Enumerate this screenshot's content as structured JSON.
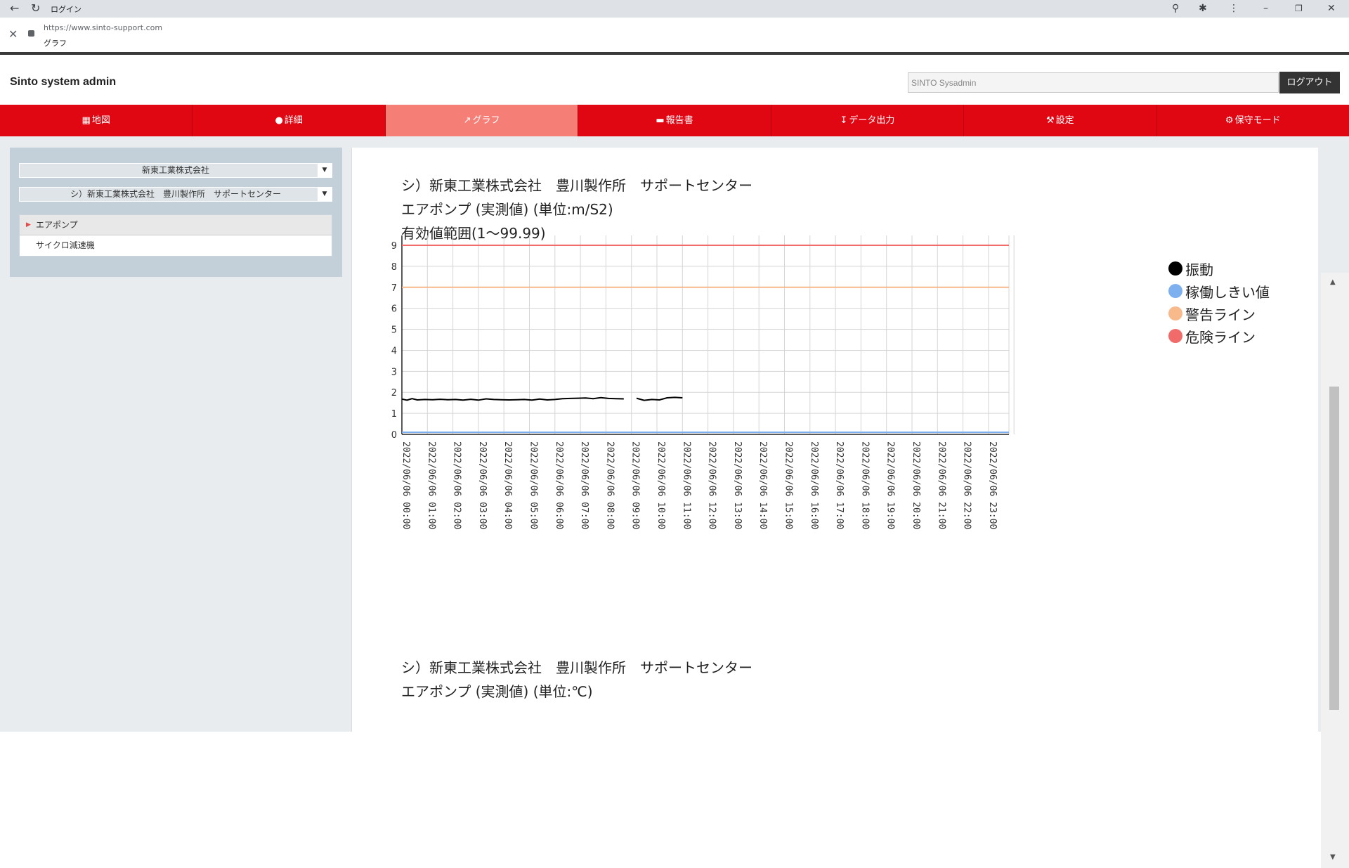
{
  "browser": {
    "tab_title": "ログイン",
    "url": "https://www.sinto-support.com",
    "page_label": "グラフ"
  },
  "header": {
    "app_title": "Sinto system admin",
    "user_value": "SINTO Sysadmin",
    "logout_label": "ログアウト"
  },
  "nav": [
    {
      "label": "地図",
      "icon": "map-icon"
    },
    {
      "label": "詳細",
      "icon": "map-marker-icon"
    },
    {
      "label": "グラフ",
      "icon": "line-chart-icon",
      "active": true
    },
    {
      "label": "報告書",
      "icon": "book-icon"
    },
    {
      "label": "データ出力",
      "icon": "download-icon"
    },
    {
      "label": "設定",
      "icon": "wrench-icon"
    },
    {
      "label": "保守モード",
      "icon": "gear-icon"
    }
  ],
  "sidebar": {
    "company_select": "新東工業株式会社",
    "site_select": "シ）新東工業株式会社　豊川製作所　サポートセンター",
    "tree": [
      {
        "label": "エアポンプ",
        "active": true
      },
      {
        "label": "サイクロ減速機",
        "active": false
      }
    ]
  },
  "charts": [
    {
      "title_line1": "シ）新東工業株式会社　豊川製作所　サポートセンター",
      "title_line2": "エアポンプ (実測値) (単位:m/S2)",
      "title_line3": "有効値範囲(1～99.99)"
    },
    {
      "title_line1": "シ）新東工業株式会社　豊川製作所　サポートセンター",
      "title_line2": "エアポンプ (実測値) (単位:℃)"
    }
  ],
  "colors": {
    "nav_red": "#e00713",
    "nav_active": "#f57f76",
    "vibration": "#000000",
    "threshold": "#7eb0f0",
    "warning": "#f8b98b",
    "danger": "#f26b6b"
  },
  "chart_data": {
    "type": "line",
    "ylim": [
      0,
      9
    ],
    "yticks": [
      0,
      1,
      2,
      3,
      4,
      5,
      6,
      7,
      8,
      9
    ],
    "categories": [
      "2022/06/06 00:00",
      "2022/06/06 01:00",
      "2022/06/06 02:00",
      "2022/06/06 03:00",
      "2022/06/06 04:00",
      "2022/06/06 05:00",
      "2022/06/06 06:00",
      "2022/06/06 07:00",
      "2022/06/06 08:00",
      "2022/06/06 09:00",
      "2022/06/06 10:00",
      "2022/06/06 11:00",
      "2022/06/06 12:00",
      "2022/06/06 13:00",
      "2022/06/06 14:00",
      "2022/06/06 15:00",
      "2022/06/06 16:00",
      "2022/06/06 17:00",
      "2022/06/06 18:00",
      "2022/06/06 19:00",
      "2022/06/06 20:00",
      "2022/06/06 21:00",
      "2022/06/06 22:00",
      "2022/06/06 23:00"
    ],
    "series": [
      {
        "name": "振動",
        "color": "#000000",
        "segments": [
          [
            [
              0.0,
              1.68
            ],
            [
              0.2,
              1.63
            ],
            [
              0.4,
              1.7
            ],
            [
              0.6,
              1.64
            ],
            [
              0.9,
              1.66
            ],
            [
              1.2,
              1.65
            ],
            [
              1.5,
              1.67
            ],
            [
              1.8,
              1.65
            ],
            [
              2.1,
              1.66
            ],
            [
              2.4,
              1.63
            ],
            [
              2.7,
              1.67
            ],
            [
              3.0,
              1.63
            ],
            [
              3.3,
              1.69
            ],
            [
              3.6,
              1.66
            ],
            [
              3.9,
              1.65
            ],
            [
              4.2,
              1.64
            ],
            [
              4.5,
              1.65
            ],
            [
              4.8,
              1.66
            ],
            [
              5.1,
              1.63
            ],
            [
              5.4,
              1.68
            ],
            [
              5.7,
              1.64
            ],
            [
              6.0,
              1.66
            ],
            [
              6.3,
              1.7
            ],
            [
              6.6,
              1.71
            ],
            [
              6.9,
              1.72
            ],
            [
              7.2,
              1.73
            ],
            [
              7.5,
              1.7
            ],
            [
              7.8,
              1.75
            ],
            [
              8.1,
              1.71
            ],
            [
              8.4,
              1.7
            ],
            [
              8.7,
              1.69
            ]
          ],
          [
            [
              9.2,
              1.72
            ],
            [
              9.5,
              1.62
            ],
            [
              9.8,
              1.66
            ],
            [
              10.1,
              1.64
            ],
            [
              10.4,
              1.74
            ],
            [
              10.7,
              1.76
            ],
            [
              11.0,
              1.74
            ]
          ]
        ]
      },
      {
        "name": "稼働しきい値",
        "color": "#7eb0f0",
        "constant": 0.1
      },
      {
        "name": "警告ライン",
        "color": "#f8b98b",
        "constant": 7
      },
      {
        "name": "危険ライン",
        "color": "#f26b6b",
        "constant": 9
      }
    ]
  }
}
